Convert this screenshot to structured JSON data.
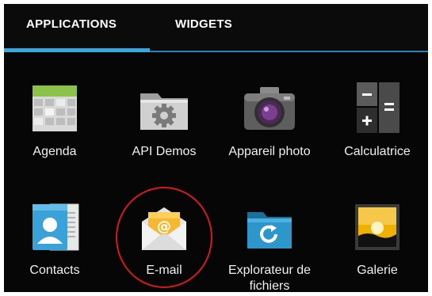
{
  "tabs": {
    "applications_label": "APPLICATIONS",
    "widgets_label": "WIDGETS",
    "selected": "APPLICATIONS"
  },
  "colors": {
    "accent_blue": "#35a9e2",
    "highlight_red": "#d51a1a",
    "background": "#060606"
  },
  "apps": [
    {
      "label": "Agenda",
      "icon": "calendar-icon"
    },
    {
      "label": "API Demos",
      "icon": "gear-folder-icon"
    },
    {
      "label": "Appareil photo",
      "icon": "camera-icon"
    },
    {
      "label": "Calculatrice",
      "icon": "calculator-icon"
    },
    {
      "label": "Contacts",
      "icon": "contacts-icon"
    },
    {
      "label": "E-mail",
      "icon": "email-icon"
    },
    {
      "label": "Explorateur de fichiers",
      "icon": "file-explorer-icon"
    },
    {
      "label": "Galerie",
      "icon": "gallery-icon"
    }
  ],
  "highlighted_app": "E-mail"
}
